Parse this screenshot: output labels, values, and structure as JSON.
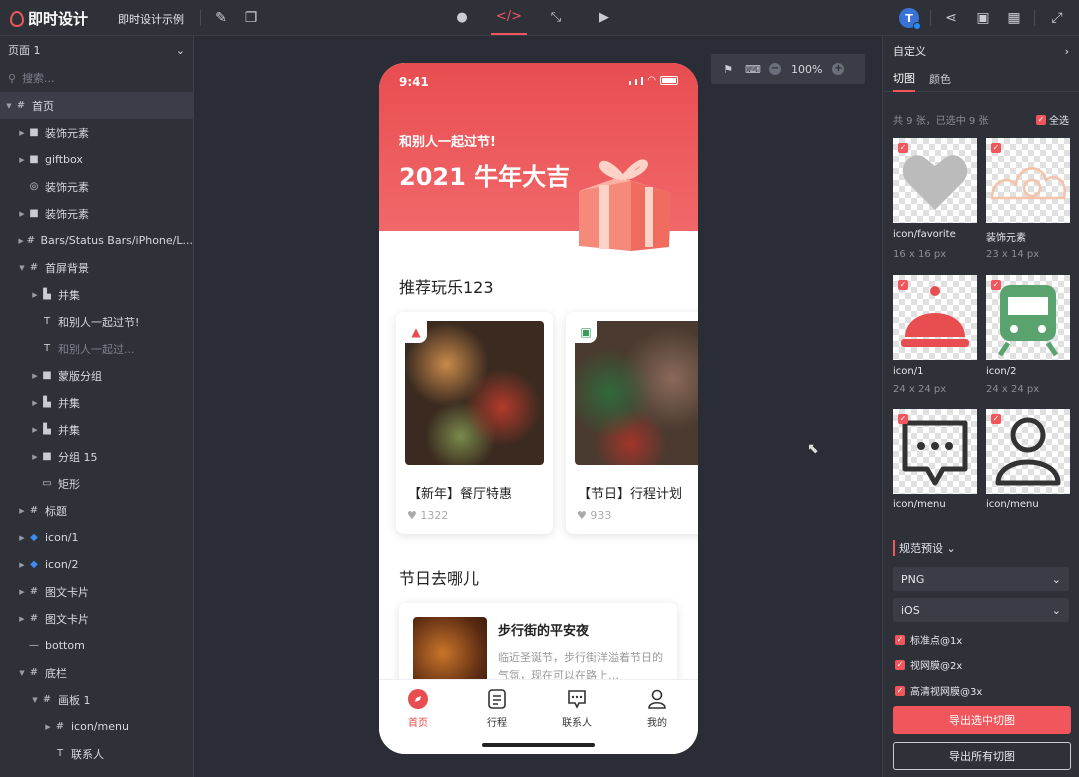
{
  "app": {
    "name": "即时设计",
    "doc_title": "即时设计示例"
  },
  "toolbar": {
    "mode_tabs": [
      "comment",
      "code",
      "prototype",
      "play"
    ],
    "active_mode": "code",
    "avatar_letter": "T"
  },
  "left_panel": {
    "page": "页面 1",
    "search_placeholder": "搜索...",
    "layers": [
      {
        "label": "首页",
        "icon": "frame"
      },
      {
        "label": "装饰元素",
        "icon": "folder"
      },
      {
        "label": "giftbox",
        "icon": "folder"
      },
      {
        "label": "装饰元素",
        "icon": "vector"
      },
      {
        "label": "装饰元素",
        "icon": "folder"
      },
      {
        "label": "Bars/Status Bars/iPhone/L...",
        "icon": "frame"
      },
      {
        "label": "首屏背景",
        "icon": "frame"
      },
      {
        "label": "并集",
        "icon": "union"
      },
      {
        "label": "和别人一起过节!",
        "icon": "text"
      },
      {
        "label": "和别人一起过...",
        "icon": "text"
      },
      {
        "label": "蒙版分组",
        "icon": "folder"
      },
      {
        "label": "并集",
        "icon": "union"
      },
      {
        "label": "并集",
        "icon": "union"
      },
      {
        "label": "分组 15",
        "icon": "folder"
      },
      {
        "label": "矩形",
        "icon": "rect"
      },
      {
        "label": "标题",
        "icon": "frame"
      },
      {
        "label": "icon/1",
        "icon": "component"
      },
      {
        "label": "icon/2",
        "icon": "component"
      },
      {
        "label": "图文卡片",
        "icon": "frame"
      },
      {
        "label": "图文卡片",
        "icon": "frame"
      },
      {
        "label": "bottom",
        "icon": "line"
      },
      {
        "label": "底栏",
        "icon": "frame"
      },
      {
        "label": "画板 1",
        "icon": "frame"
      },
      {
        "label": "icon/menu",
        "icon": "frame"
      },
      {
        "label": "联系人",
        "icon": "text"
      }
    ]
  },
  "canvas": {
    "zoom": "100%"
  },
  "phone": {
    "time": "9:41",
    "hero_sub": "和别人一起过节!",
    "hero_title": "2021 牛年大吉",
    "section1": "推荐玩乐123",
    "cards": [
      {
        "title": "【新年】餐厅特惠",
        "likes": "1322"
      },
      {
        "title": "【节日】行程计划",
        "likes": "933"
      }
    ],
    "section2": "节日去哪儿",
    "article": {
      "title": "步行街的平安夜",
      "desc": "临近圣诞节，步行街洋溢着节日的气氛，现在可以在路上…"
    },
    "tabs": [
      {
        "label": "首页",
        "icon": "compass-icon"
      },
      {
        "label": "行程",
        "icon": "document-icon"
      },
      {
        "label": "联系人",
        "icon": "chat-icon"
      },
      {
        "label": "我的",
        "icon": "user-icon"
      }
    ]
  },
  "right_panel": {
    "header": "自定义",
    "tabs": [
      "切图",
      "颜色"
    ],
    "count_text": "共 9 张，已选中 9 张",
    "select_all": "全选",
    "slices": [
      {
        "name": "icon/favorite",
        "size": "16 x 16 px"
      },
      {
        "name": "装饰元素",
        "size": "23 x 14 px"
      },
      {
        "name": "icon/1",
        "size": "24 x 24 px"
      },
      {
        "name": "icon/2",
        "size": "24 x 24 px"
      },
      {
        "name": "icon/menu",
        "size": ""
      },
      {
        "name": "icon/menu",
        "size": ""
      }
    ],
    "preset_label": "规范预设",
    "format": "PNG",
    "platform": "iOS",
    "options": [
      "标准点@1x",
      "视网膜@2x",
      "高清视网膜@3x"
    ],
    "export_selected": "导出选中切图",
    "export_all": "导出所有切图"
  },
  "colors": {
    "accent": "#f0565b",
    "panel": "#2f3139",
    "canvas": "#2b2d36"
  }
}
